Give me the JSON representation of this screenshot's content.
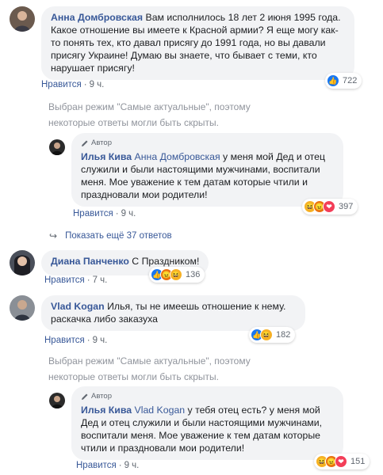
{
  "comments": [
    {
      "author": "Анна Домбровская",
      "text": "Вам исполнилось 18 лет 2 июня 1995 года. Какое отношение вы имеете к Красной армии? Я еще могу как-то понять тех, кто давал присягу до 1991 года, но вы давали присягу Украине! Думаю вы знаете, что бывает с теми, кто нарушает присягу!",
      "like_label": "Нравится",
      "time": "9 ч.",
      "reaction_count": "722"
    },
    {
      "badge": "Автор",
      "author": "Илья Кива",
      "mention": "Анна Домбровская",
      "text": "у меня мой Дед и отец служили и были настоящими мужчинами, воспитали меня. Мое уважение к тем датам которые чтили и праздновали мои родители!",
      "like_label": "Нравится",
      "time": "9 ч.",
      "reaction_count": "397"
    },
    {
      "author": "Диана Панченко",
      "text": "С Праздником!",
      "like_label": "Нравится",
      "time": "7 ч.",
      "reaction_count": "136"
    },
    {
      "author": "Vlad Kogan",
      "text": "Илья, ты не имеешь отношение к нему. раскачка либо заказуха",
      "like_label": "Нравится",
      "time": "9 ч.",
      "reaction_count": "182"
    },
    {
      "badge": "Автор",
      "author": "Илья Кива",
      "mention": "Vlad Kogan",
      "text": "у тебя отец есть? у меня мой Дед и отец служили и были настоящими мужчинами, воспитали меня. Мое уважение к тем датам которые чтили и праздновали мои родители!",
      "like_label": "Нравится",
      "time": "9 ч.",
      "reaction_count": "151"
    }
  ],
  "notice_text": "Выбран режим \"Самые актуальные\", поэтому некоторые ответы могли быть скрыты.",
  "more_replies": "Показать ещё 37 ответов",
  "separator": "·",
  "colors": {
    "link": "#385898",
    "bubble": "#f2f3f5",
    "meta": "#606770",
    "notice": "#90949c"
  }
}
